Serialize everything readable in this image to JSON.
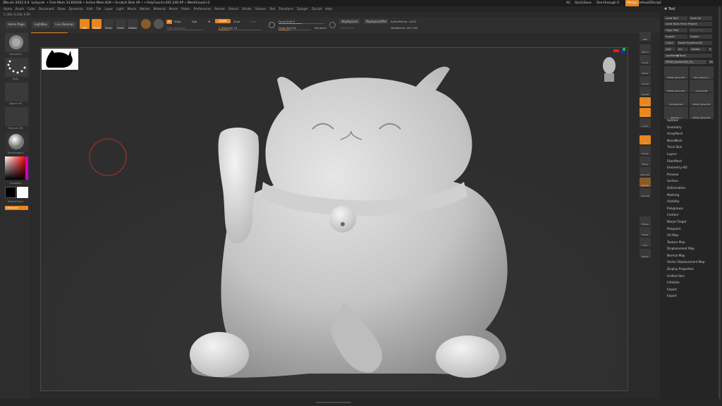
{
  "titlebar": {
    "app": "ZBrush 2022.0.6",
    "project": "luckycat",
    "stats": "• Free Mem 33.850GB • Active Mem 839 • Scratch Disk 49 • • PolyCount>201.246 KP • MeshCount>2",
    "ac": "AC",
    "quicksave": "QuickSave",
    "seethrough": "See-through 0",
    "menus": "Menus",
    "defaultzscript": "DefaultZScript"
  },
  "menu": [
    "Alpha",
    "Brush",
    "Color",
    "Document",
    "Draw",
    "Dynamics",
    "Edit",
    "File",
    "Layer",
    "Light",
    "Macro",
    "Marker",
    "Material",
    "Movie",
    "Picker",
    "Preferences",
    "Render",
    "Stencil",
    "Stroke",
    "Texture",
    "Tool",
    "Transform",
    "Zplugin",
    "Zscript",
    "Help"
  ],
  "coords": "-1.008,-0.428,-0.09",
  "shelf": {
    "home": "Home Page",
    "lightbox": "LightBox",
    "liveboolean": "Live Boolean",
    "edit": "Edit",
    "draw": "Draw",
    "move": "Move",
    "scale": "Scale",
    "rotate": "Rotate",
    "a": "A",
    "mrgb": "Mrgb",
    "rgb": "Rgb",
    "m": "M",
    "rgb_intensity": "Rgb Intensity",
    "zadd": "Zadd",
    "zsub": "Zsub",
    "zcut": "Zcut",
    "z_intensity": "Z Intensity 25",
    "focal_shift": "Focal Shift 0",
    "draw_size": "Draw Size 64",
    "dynamic": "Dynamic",
    "replaylast": "ReplayLast",
    "replaylastrel": "ReplayLastRel",
    "polyframe": "PolyFrame",
    "activepoints": "ActivePoints: 4.832",
    "totalpoints": "TotalPoints: 201.250"
  },
  "left": {
    "brush": "Standard",
    "stroke": "Dots",
    "alpha": "Alpha Off",
    "texture": "Texture Off",
    "material": "SkinShade4",
    "gradient": "Gradient",
    "switchcolor": "SwitchColor",
    "alternate": "Alternate"
  },
  "rightshelf": [
    "BPR",
    "SPix 3",
    "Scroll",
    "Zoom",
    "Actual",
    "AAHalf",
    "Persp",
    "Floor",
    "L.Sym",
    "XYZ",
    "Frame",
    "Move",
    "Zoom3D",
    "Rotate",
    "Line Fill PolyF",
    "Transp",
    "Ghost",
    "Solo",
    "Xpose"
  ],
  "tool": {
    "header": "Tool",
    "load": "Load Tool",
    "save": "Save As",
    "loadproject": "Load Tools From Project",
    "copy": "Copy Tool",
    "paste": "Paste Tool",
    "import": "Import",
    "export": "Export",
    "clone": "Clone",
    "makepoly": "Make PolyMesh3D",
    "goz": "GoZ",
    "all": "All",
    "visible": "Visible",
    "r": "R",
    "lightbox": "Lightbox▶Tools",
    "current": "PM3D_Sphere3D_52_",
    "count": "48",
    "thumbs": [
      "PM3D_Sphere3D",
      "Skin_Sphere_1",
      "PM3D_Sphere3D",
      "Cylinder3D",
      "SimpleBrush",
      "PM3D_Sphere3D",
      "ZSphere_1",
      "PM3D_Sphere3D"
    ],
    "subpalettes": [
      "Subtool",
      "Geometry",
      "ArrayMesh",
      "NanoMesh",
      "Thick Skin",
      "Layers",
      "FiberMesh",
      "Geometry HD",
      "Preview",
      "Surface",
      "Deformation",
      "Masking",
      "Visibility",
      "Polygroups",
      "Contact",
      "Morph Target",
      "Polypaint",
      "UV Map",
      "Texture Map",
      "Displacement Map",
      "Normal Map",
      "Vector Displacement Map",
      "Display Properties",
      "Unified Skin",
      "Initialize",
      "Import",
      "Export"
    ]
  },
  "colors": {
    "accent": "#e8861f",
    "bg": "#2a2a2a",
    "mesh": "#c9c9c9"
  }
}
